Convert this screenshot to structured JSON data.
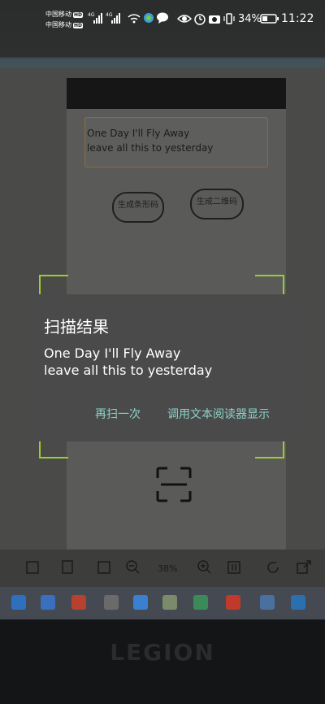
{
  "status_bar": {
    "carrier_1": "中国移动",
    "carrier_2": "中国移动",
    "hd_badge": "HD",
    "network_1": "4G",
    "network_2": "4G",
    "battery_percent": "34%",
    "time": "11:22",
    "icons": [
      "signal-icon",
      "wifi-icon",
      "hotspot-icon",
      "chat-icon",
      "eye-icon",
      "alarm-icon",
      "camera-icon",
      "vibrate-icon",
      "battery-icon"
    ]
  },
  "background": {
    "captured_text_line_1": "One Day I'll Fly Away",
    "captured_text_line_2": "leave all this to yesterday",
    "barcode_button": "生成条形码",
    "qrcode_button": "生成二维码",
    "zoom_level": "38%",
    "logo_text": "LEGION"
  },
  "dialog": {
    "title": "扫描结果",
    "message": "One Day I'll Fly Away\nleave all this to yesterday",
    "rescan_button": "再扫一次",
    "open_reader_button": "调用文本阅读器显示"
  },
  "colors": {
    "dialog_bg": "#4a4a4a",
    "accent": "#8fd3c8",
    "scan_corner": "#9acd32"
  }
}
